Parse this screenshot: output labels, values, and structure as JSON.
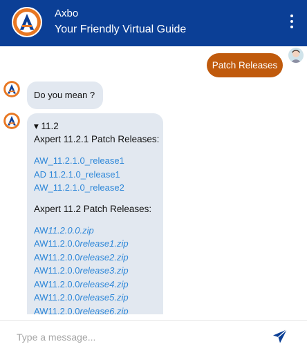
{
  "header": {
    "name": "Axbo",
    "subtitle": "Your Friendly Virtual Guide"
  },
  "messages": {
    "user_query": "Patch Releases",
    "bot_prompt": "Do you mean ?",
    "version_toggle": "▾ 11.2",
    "section1": {
      "title": "Axpert 11.2.1 Patch Releases:",
      "links": [
        "AW_11.2.1.0_release1",
        "AD 11.2.1.0_release1",
        "AW_11.2.1.0_release2"
      ]
    },
    "section2": {
      "title": "Axpert 11.2 Patch Releases:",
      "links": [
        {
          "prefix": "AW",
          "suffix": "11.2.0.0.zip"
        },
        {
          "prefix": "AW11.2.0.0",
          "suffix": "release1.zip"
        },
        {
          "prefix": "AW11.2.0.0",
          "suffix": "release2.zip"
        },
        {
          "prefix": "AW11.2.0.0",
          "suffix": "release3.zip"
        },
        {
          "prefix": "AW11.2.0.0",
          "suffix": "release4.zip"
        },
        {
          "prefix": "AW11.2.0.0",
          "suffix": "release5.zip"
        },
        {
          "prefix": "AW11.2.0.0",
          "suffix": "release6.zip"
        }
      ]
    }
  },
  "composer": {
    "placeholder": "Type a message..."
  },
  "colors": {
    "header": "#0b3f96",
    "user_bubble": "#c05a0c",
    "bot_bubble": "#e2e8f0",
    "link": "#2e87d8",
    "send": "#0b3f96"
  },
  "icons": {
    "logo": "axbo-logo-icon",
    "menu": "kebab-menu-icon",
    "send": "send-icon",
    "user": "user-avatar-icon"
  }
}
